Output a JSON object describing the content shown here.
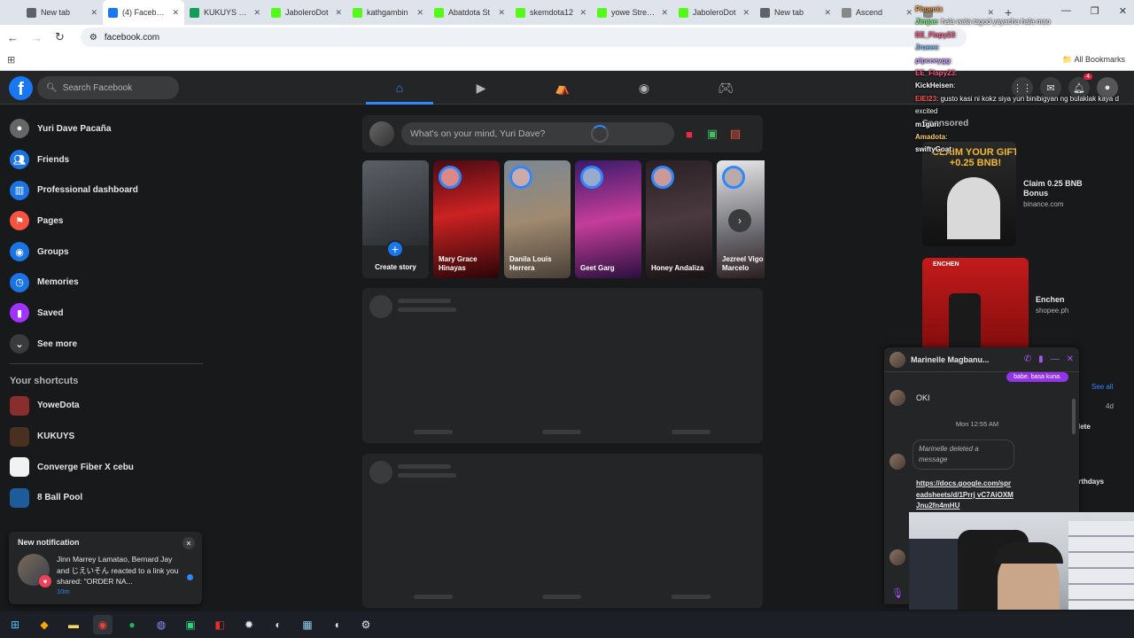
{
  "browser": {
    "tabs": [
      {
        "title": "New tab",
        "color": "#5f6368"
      },
      {
        "title": "(4) Facebook",
        "color": "#1877f2",
        "active": true
      },
      {
        "title": "KUKUYS BAS",
        "color": "#0f9d58"
      },
      {
        "title": "JaboleroDot",
        "color": "#53fc18"
      },
      {
        "title": "kathgambin",
        "color": "#53fc18"
      },
      {
        "title": "Abatdota St",
        "color": "#53fc18"
      },
      {
        "title": "skemdota12",
        "color": "#53fc18"
      },
      {
        "title": "yowe Stream",
        "color": "#53fc18"
      },
      {
        "title": "JaboleroDot",
        "color": "#53fc18"
      },
      {
        "title": "New tab",
        "color": "#5f6368"
      },
      {
        "title": "Ascend",
        "color": "#888888"
      },
      {
        "title": "",
        "color": "#888888"
      }
    ],
    "url": "facebook.com",
    "all_bookmarks": "All Bookmarks"
  },
  "fb": {
    "search_placeholder": "Search Facebook",
    "notif_count": "4"
  },
  "sidebar": {
    "items": [
      {
        "label": "Yuri Dave Pacaña",
        "icon": "avatar",
        "color": "#666666"
      },
      {
        "label": "Friends",
        "icon": "friends-icon",
        "color": "#1b74e4"
      },
      {
        "label": "Professional dashboard",
        "icon": "dashboard-icon",
        "color": "#1b74e4"
      },
      {
        "label": "Pages",
        "icon": "flag-icon",
        "color": "#f7533e"
      },
      {
        "label": "Groups",
        "icon": "groups-icon",
        "color": "#1b74e4"
      },
      {
        "label": "Memories",
        "icon": "clock-icon",
        "color": "#1b74e4"
      },
      {
        "label": "Saved",
        "icon": "bookmark-icon",
        "color": "#a033ff"
      },
      {
        "label": "See more",
        "icon": "chevron-down-icon",
        "color": "#3a3b3c"
      }
    ],
    "shortcuts_title": "Your shortcuts",
    "shortcuts": [
      {
        "label": "YoweDota"
      },
      {
        "label": "KUKUYS"
      },
      {
        "label": "Converge Fiber X cebu"
      },
      {
        "label": "8 Ball Pool"
      }
    ]
  },
  "notification": {
    "title": "New notification",
    "text": "Jinn Marrey Lamatao, Bernard Jay and じえいそん reacted to a link you shared: \"ORDER NA...",
    "time": "10m"
  },
  "composer": {
    "placeholder": "What's on your mind, Yuri Dave?"
  },
  "stories": [
    {
      "name": "Create story"
    },
    {
      "name": "Mary Grace Hinayas"
    },
    {
      "name": "Danila Louis Herrera"
    },
    {
      "name": "Geet Garg"
    },
    {
      "name": "Honey Andaliza"
    },
    {
      "name": "Jezreel Vigo Marcelo"
    }
  ],
  "right": {
    "sponsored": "Sponsored",
    "ads": [
      {
        "title": "Claim 0.25 BNB Bonus",
        "domain": "binance.com",
        "headline": "CLAIM YOUR GIFT +0.25 BNB!"
      },
      {
        "title": "Enchen",
        "domain": "shopee.ph",
        "headline": "ENCHEN"
      }
    ],
    "see_all": "See all",
    "time_4d": "4d",
    "delete_label": "lete",
    "birthdays_label": "irthdays"
  },
  "stream_chat": [
    {
      "user": "Phoenix",
      "text": ""
    },
    {
      "user": "Jimjae",
      "text": ": hala wala tagod yayacha hala mao"
    },
    {
      "user": "EE_Flapy23",
      "text": ":"
    },
    {
      "user": "Jrueee",
      "text": ":"
    },
    {
      "user": "pipceeygg",
      "text": ":"
    },
    {
      "user": "EE_Flapy23",
      "text": ":"
    },
    {
      "user": "KickHeisen",
      "text": ":"
    },
    {
      "user": "EIEI23",
      "text": ": gusto kasi ni kokz siya yun binibigyan ng bulaklak kaya d excited"
    },
    {
      "user": "m1guri",
      "text": ":"
    },
    {
      "user": "Amadota",
      "text": ":"
    },
    {
      "user": "swiftyGoat",
      "text": ":"
    }
  ],
  "messenger": {
    "contact": "Marinelle Magbanu...",
    "my_bubble": "babe. basa kuna.",
    "ok": "OKI",
    "timestamp": "Mon 12:55 AM",
    "deleted": "Marinelle deleted a message",
    "link": "https://docs.google.com/spreadsheets/d/1Prrj vC7AiOXMJnu2fn4mHU"
  }
}
